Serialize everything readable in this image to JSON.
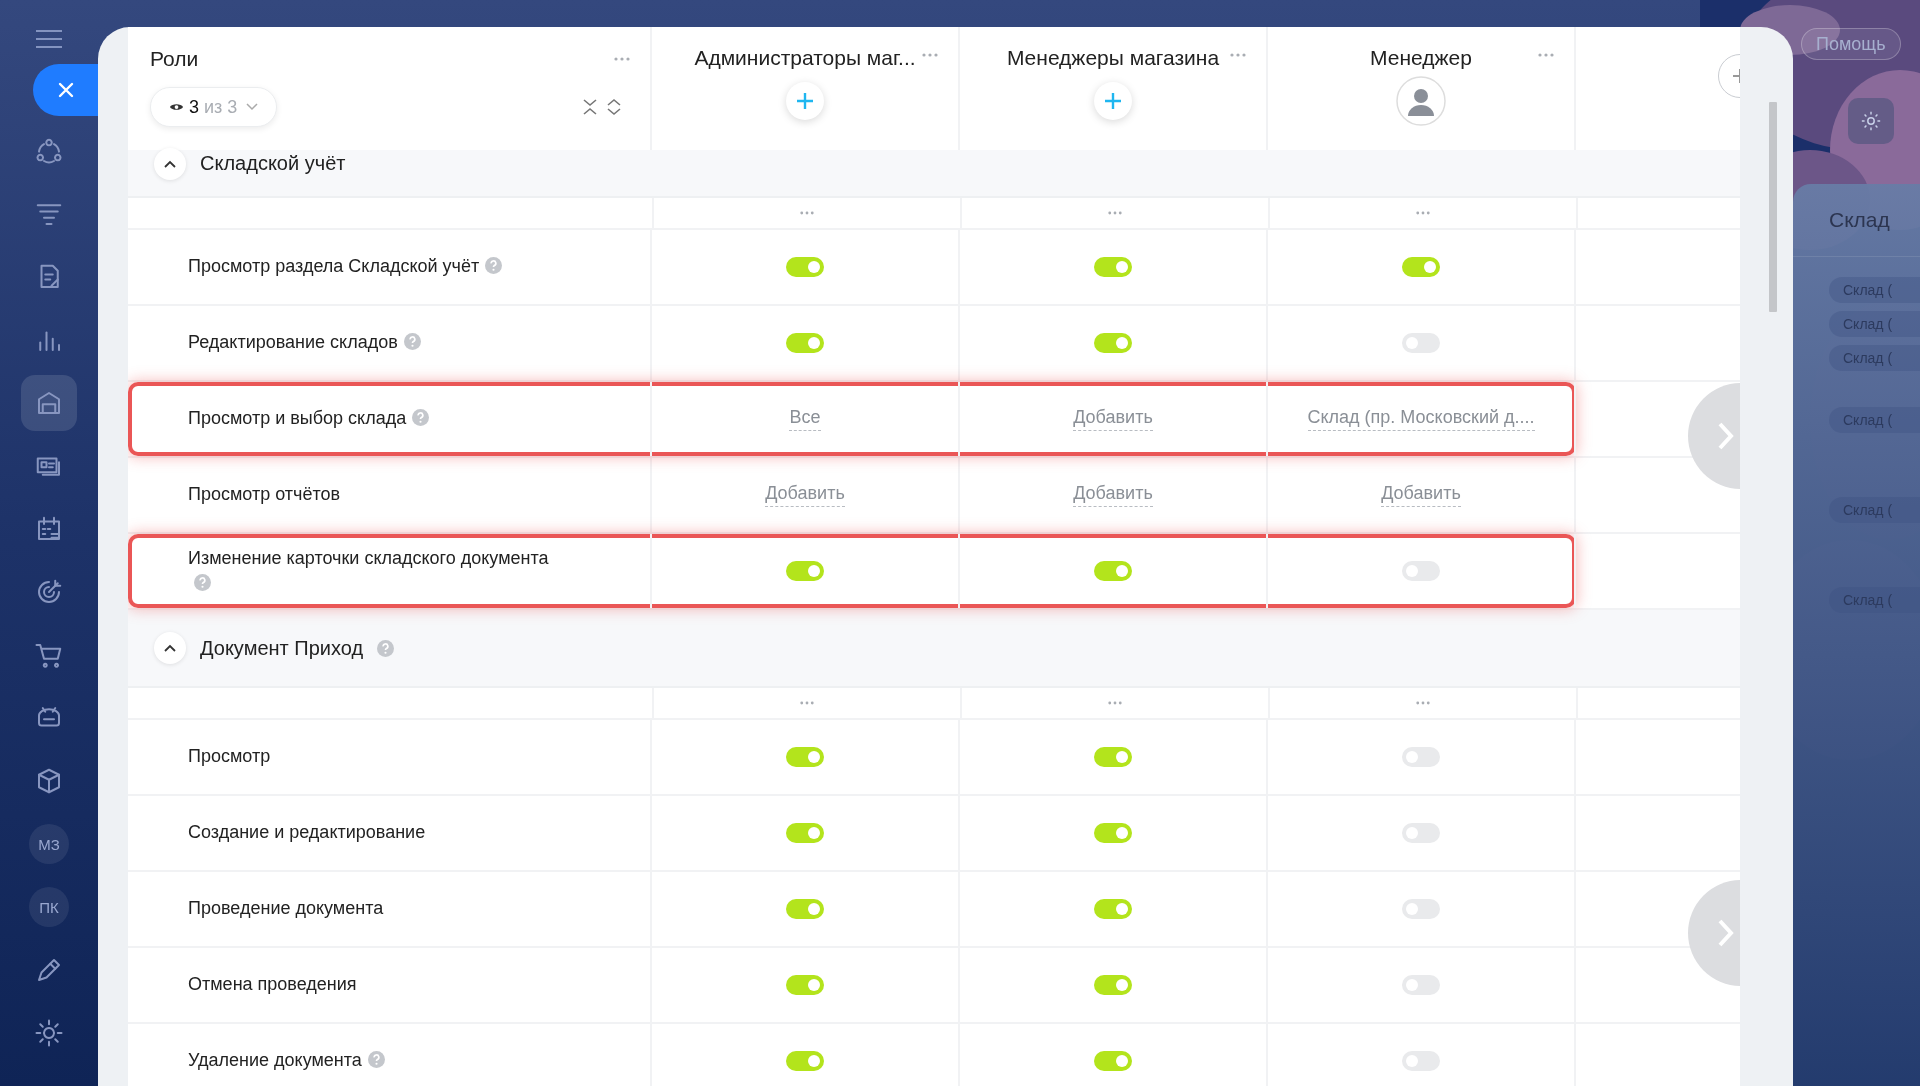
{
  "sidebar": {
    "items": [
      {
        "kind": "icon",
        "selected": false
      },
      {
        "kind": "icon",
        "selected": false
      },
      {
        "kind": "icon",
        "selected": false
      },
      {
        "kind": "icon",
        "selected": false
      },
      {
        "kind": "icon",
        "selected": true
      },
      {
        "kind": "icon",
        "selected": false
      },
      {
        "kind": "icon",
        "selected": false
      },
      {
        "kind": "icon",
        "selected": false
      },
      {
        "kind": "icon",
        "selected": false
      },
      {
        "kind": "icon",
        "selected": false
      },
      {
        "kind": "icon",
        "selected": false
      },
      {
        "kind": "initials",
        "label": "МЗ",
        "selected": false
      },
      {
        "kind": "initials",
        "label": "ПК",
        "selected": false
      },
      {
        "kind": "icon",
        "selected": false
      },
      {
        "kind": "icon",
        "selected": false
      }
    ]
  },
  "roles": {
    "title": "Роли",
    "filter": {
      "shown": "3",
      "total": "из 3"
    },
    "columns": [
      {
        "title": "Администраторы маг...",
        "kind": "add"
      },
      {
        "title": "Менеджеры магазина",
        "kind": "add"
      },
      {
        "title": "Менеджер",
        "kind": "avatar"
      }
    ],
    "sections": [
      {
        "title": "Складской учёт",
        "expanded": true,
        "help": false,
        "rows": [
          {
            "label": "Просмотр раздела Складской учёт",
            "help": true,
            "highlighted": false,
            "cells": [
              {
                "kind": "toggle",
                "on": true
              },
              {
                "kind": "toggle",
                "on": true
              },
              {
                "kind": "toggle",
                "on": true
              }
            ]
          },
          {
            "label": "Редактирование складов",
            "help": true,
            "highlighted": false,
            "cells": [
              {
                "kind": "toggle",
                "on": true
              },
              {
                "kind": "toggle",
                "on": true
              },
              {
                "kind": "toggle",
                "on": false
              }
            ]
          },
          {
            "label": "Просмотр и выбор склада",
            "help": true,
            "highlighted": true,
            "cells": [
              {
                "kind": "link",
                "text": "Все"
              },
              {
                "kind": "link",
                "text": "Добавить"
              },
              {
                "kind": "link",
                "text": "Склад (пр. Московский д...."
              }
            ]
          },
          {
            "label": "Просмотр отчётов",
            "help": false,
            "highlighted": false,
            "cells": [
              {
                "kind": "link",
                "text": "Добавить"
              },
              {
                "kind": "link",
                "text": "Добавить"
              },
              {
                "kind": "link",
                "text": "Добавить"
              }
            ]
          },
          {
            "label": "Изменение карточки складского документа",
            "help": true,
            "highlighted": true,
            "cells": [
              {
                "kind": "toggle",
                "on": true
              },
              {
                "kind": "toggle",
                "on": true
              },
              {
                "kind": "toggle",
                "on": false
              }
            ]
          }
        ]
      },
      {
        "title": "Документ Приход",
        "expanded": true,
        "help": true,
        "rows": [
          {
            "label": "Просмотр",
            "help": false,
            "highlighted": false,
            "cells": [
              {
                "kind": "toggle",
                "on": true
              },
              {
                "kind": "toggle",
                "on": true
              },
              {
                "kind": "toggle",
                "on": false
              }
            ]
          },
          {
            "label": "Создание и редактирование",
            "help": false,
            "highlighted": false,
            "cells": [
              {
                "kind": "toggle",
                "on": true
              },
              {
                "kind": "toggle",
                "on": true
              },
              {
                "kind": "toggle",
                "on": false
              }
            ]
          },
          {
            "label": "Проведение документа",
            "help": false,
            "highlighted": false,
            "cells": [
              {
                "kind": "toggle",
                "on": true
              },
              {
                "kind": "toggle",
                "on": true
              },
              {
                "kind": "toggle",
                "on": false
              }
            ]
          },
          {
            "label": "Отмена проведения",
            "help": false,
            "highlighted": false,
            "cells": [
              {
                "kind": "toggle",
                "on": true
              },
              {
                "kind": "toggle",
                "on": true
              },
              {
                "kind": "toggle",
                "on": false
              }
            ]
          },
          {
            "label": "Удаление документа",
            "help": true,
            "highlighted": false,
            "cells": [
              {
                "kind": "toggle",
                "on": true
              },
              {
                "kind": "toggle",
                "on": true
              },
              {
                "kind": "toggle",
                "on": false
              }
            ]
          }
        ]
      }
    ]
  },
  "help_button": "Помощь",
  "side_panel": {
    "title": "Склад",
    "chips": [
      "Склад (",
      "Склад (",
      "Склад (",
      "Склад (",
      "Склад (",
      "Склад ("
    ]
  }
}
